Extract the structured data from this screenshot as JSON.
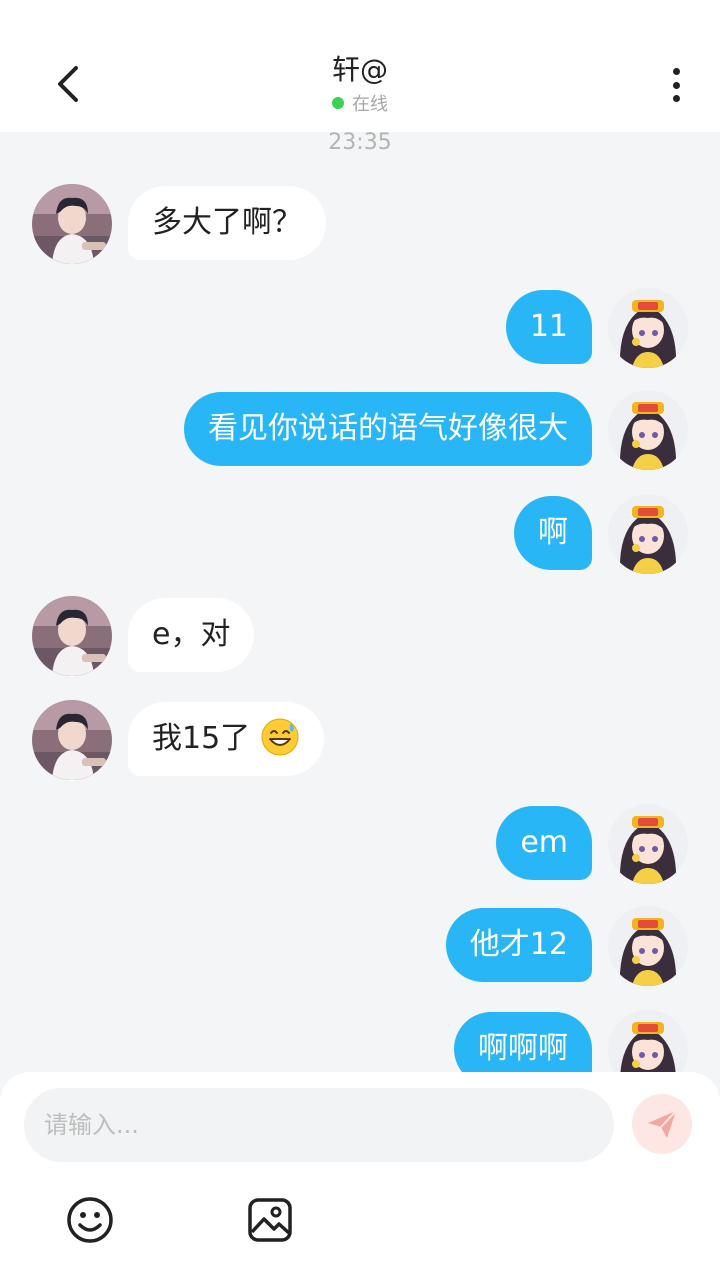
{
  "header": {
    "title": "轩@",
    "status": "在线",
    "status_color": "#39d353"
  },
  "icons": {
    "back": "back-arrow-icon",
    "more": "more-vertical-icon",
    "send": "send-icon",
    "emoji": "emoji-icon",
    "image": "image-icon"
  },
  "chat": {
    "timestamp": "23:35",
    "messages": [
      {
        "side": "in",
        "text": "多大了啊？"
      },
      {
        "side": "out",
        "text": "11"
      },
      {
        "side": "out",
        "text": "看见你说话的语气好像很大"
      },
      {
        "side": "out",
        "text": "啊"
      },
      {
        "side": "in",
        "text": "e，对"
      },
      {
        "side": "in",
        "text": "我15了",
        "emoji": "grinning-sweat-emoji"
      },
      {
        "side": "out",
        "text": "em"
      },
      {
        "side": "out",
        "text": "他才12"
      },
      {
        "side": "out",
        "text": "啊啊啊"
      }
    ]
  },
  "composer": {
    "placeholder": "请输入..."
  },
  "colors": {
    "outgoing_bubble": "#29b6f6",
    "incoming_bubble": "#ffffff",
    "background": "#f3f5f7"
  }
}
